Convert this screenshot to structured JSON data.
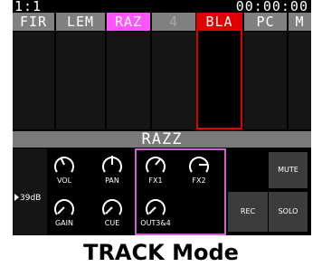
{
  "status": {
    "left": "1:1",
    "time": "00:00:00"
  },
  "tracks": [
    {
      "label": "FIR"
    },
    {
      "label": "LEM"
    },
    {
      "label": "RAZ"
    },
    {
      "label": "4"
    },
    {
      "label": "BLA"
    },
    {
      "label": "PC"
    },
    {
      "label": "M"
    }
  ],
  "track_name": "RAZZ",
  "mixer": {
    "db": "39dB",
    "knobs": {
      "vol": "VOL",
      "pan": "PAN",
      "fx1": "FX1",
      "fx2": "FX2",
      "gain": "GAIN",
      "cue": "CUE",
      "out": "OUT3&4"
    },
    "buttons": {
      "mute": "MUTE",
      "rec": "REC",
      "solo": "SOLO"
    }
  },
  "caption": "TRACK Mode",
  "colors": {
    "selected": "#ff55ff",
    "active": "#e00000",
    "fx_outline": "#d060d0"
  }
}
